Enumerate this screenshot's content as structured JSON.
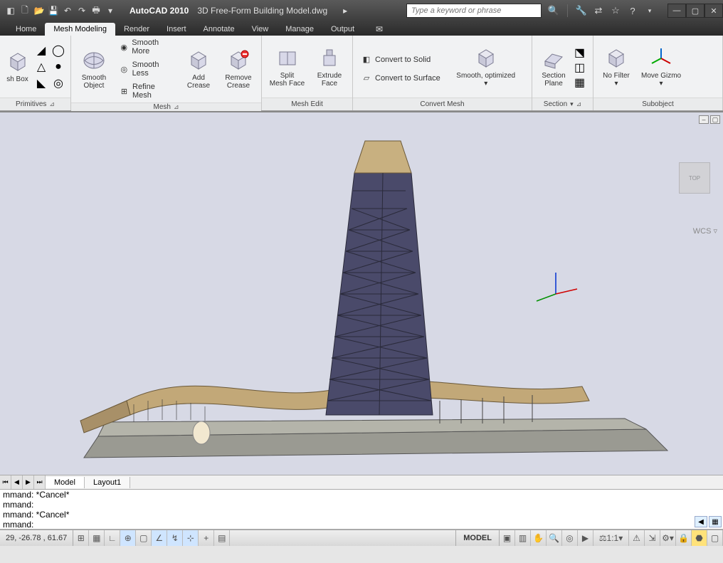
{
  "app": {
    "title": "AutoCAD 2010",
    "document": "3D Free-Form Building Model.dwg",
    "search_placeholder": "Type a keyword or phrase"
  },
  "tabs": [
    "Home",
    "Mesh Modeling",
    "Render",
    "Insert",
    "Annotate",
    "View",
    "Manage",
    "Output"
  ],
  "active_tab": "Mesh Modeling",
  "ribbon": {
    "primitives": {
      "label": "Primitives",
      "mesh_box": "sh Box"
    },
    "mesh": {
      "label": "Mesh",
      "smooth_object": "Smooth\nObject",
      "smooth_more": "Smooth More",
      "smooth_less": "Smooth Less",
      "refine_mesh": "Refine Mesh",
      "add_crease": "Add\nCrease",
      "remove_crease": "Remove\nCrease"
    },
    "mesh_edit": {
      "label": "Mesh Edit",
      "split_face": "Split\nMesh Face",
      "extrude_face": "Extrude\nFace"
    },
    "convert": {
      "label": "Convert Mesh",
      "to_solid": "Convert to Solid",
      "to_surface": "Convert to Surface",
      "smooth_opt": "Smooth, optimized"
    },
    "section": {
      "label": "Section",
      "plane": "Section\nPlane"
    },
    "subobject": {
      "label": "Subobject",
      "no_filter": "No Filter",
      "move_gizmo": "Move Gizmo"
    }
  },
  "viewport": {
    "wcs": "WCS",
    "cube_face": "TOP"
  },
  "layout_tabs": {
    "model": "Model",
    "layout1": "Layout1"
  },
  "command": {
    "l1": "mmand: *Cancel*",
    "l2": "mmand:",
    "l3": "mmand: *Cancel*",
    "l4": "mmand:"
  },
  "status": {
    "coords": "29,  -26.78 , 61.67",
    "model": "MODEL",
    "scale": "1:1"
  }
}
